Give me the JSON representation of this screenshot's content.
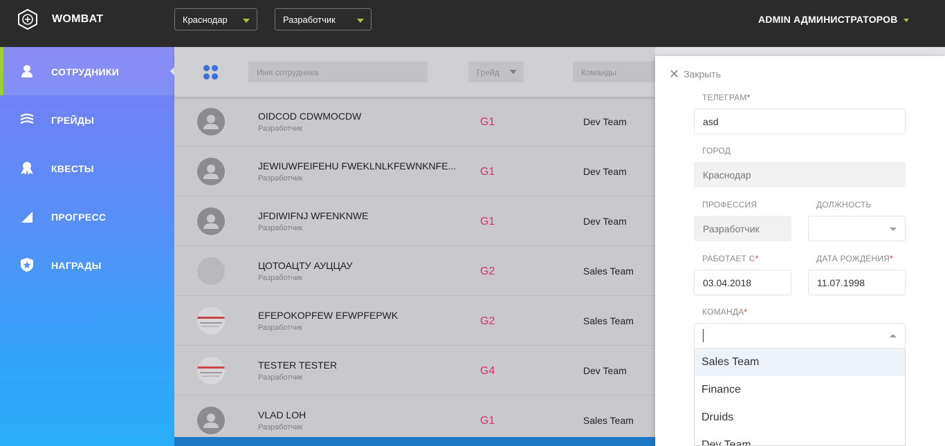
{
  "app": {
    "title": "WOMBAT"
  },
  "topbar": {
    "city_select": "Краснодар",
    "profession_select": "Разработчик",
    "user_name": "ADMIN АДМИНИСТРАТОРОВ"
  },
  "sidebar": {
    "items": [
      {
        "label": "СОТРУДНИКИ",
        "icon": "user-icon",
        "active": true
      },
      {
        "label": "ГРЕЙДЫ",
        "icon": "layers-icon",
        "active": false
      },
      {
        "label": "КВЕСТЫ",
        "icon": "badge-icon",
        "active": false
      },
      {
        "label": "ПРОГРЕСС",
        "icon": "signal-icon",
        "active": false
      },
      {
        "label": "НАГРАДЫ",
        "icon": "shield-star-icon",
        "active": false
      }
    ]
  },
  "filters": {
    "name_placeholder": "Имя сотрудника",
    "grade_placeholder": "Грейд",
    "teams_placeholder": "Команды"
  },
  "employees": [
    {
      "name": "OIDCOD CDWMOCDW",
      "role": "Разработчик",
      "grade": "G1",
      "team": "Dev Team",
      "avatar": "default"
    },
    {
      "name": "JEWIUWFEIFEHU FWEKLNLKFEWNKNFE...",
      "role": "Разработчик",
      "grade": "G1",
      "team": "Dev Team",
      "avatar": "default"
    },
    {
      "name": "JFDIWIFNJ WFENKNWE",
      "role": "Разработчик",
      "grade": "G1",
      "team": "Dev Team",
      "avatar": "default"
    },
    {
      "name": "ЦОТОАЦТУ АУЦЦАУ",
      "role": "Разработчик",
      "grade": "G2",
      "team": "Sales Team",
      "avatar": "plain"
    },
    {
      "name": "EFEPOKOPFEW EFWPFEPWK",
      "role": "Разработчик",
      "grade": "G2",
      "team": "Sales Team",
      "avatar": "image"
    },
    {
      "name": "TESTER TESTER",
      "role": "Разработчик",
      "grade": "G4",
      "team": "Dev Team",
      "avatar": "image"
    },
    {
      "name": "VLAD LOH",
      "role": "Разработчик",
      "grade": "G1",
      "team": "Sales Team",
      "avatar": "default"
    }
  ],
  "panel": {
    "close_label": "Закрыть",
    "telegram_label": "ТЕЛЕГРАМ",
    "telegram_value": "asd",
    "city_label": "ГОРОД",
    "city_value": "Краснодар",
    "profession_label": "ПРОФЕССИЯ",
    "profession_value": "Разработчик",
    "position_label": "ДОЛЖНОСТЬ",
    "position_value": "",
    "works_since_label": "РАБОТАЕТ С",
    "works_since_value": "03.04.2018",
    "birthdate_label": "ДАТА РОЖДЕНИЯ",
    "birthdate_value": "11.07.1998",
    "team_label": "КОМАНДА",
    "team_value": "",
    "required_mark": "*",
    "team_options": [
      "Sales Team",
      "Finance",
      "Druids",
      "Dev Team"
    ],
    "highlighted_option": "Sales Team"
  },
  "colors": {
    "topbar": "#2b2b2b",
    "accent_green": "#9ccc3c",
    "grade": "#d6336c",
    "required": "#e0392b"
  }
}
